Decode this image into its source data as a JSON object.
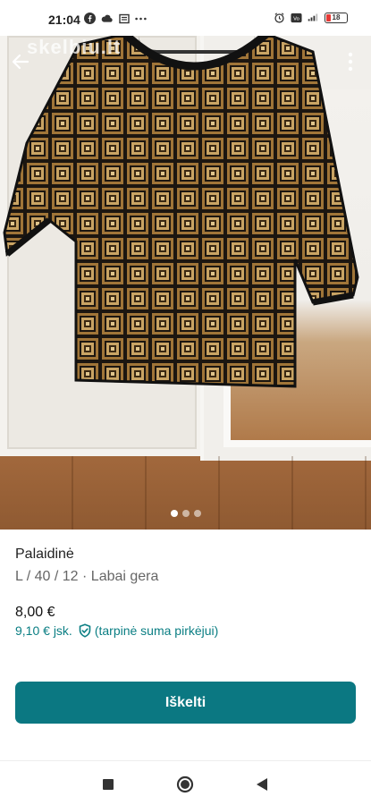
{
  "status_bar": {
    "time": "21:04",
    "left_icons": [
      "facebook-icon",
      "cloud-icon",
      "news-icon",
      "more-dots-icon"
    ],
    "right_icons": [
      "alarm-icon",
      "volte-icon",
      "signal-icon"
    ],
    "battery_level": "18"
  },
  "photo": {
    "watermark": "skelbiu.lt",
    "page_count": 3,
    "active_page": 1
  },
  "listing": {
    "title": "Palaidinė",
    "details": "L / 40 / 12 · Labai gera",
    "price": "8,00 €",
    "total_price": "9,10 € jsk.",
    "total_note": "(tarpinė suma pirkėjui)"
  },
  "actions": {
    "primary_label": "Iškelti"
  },
  "colors": {
    "accent": "#0b7882",
    "accent_text": "#0a7e83"
  }
}
